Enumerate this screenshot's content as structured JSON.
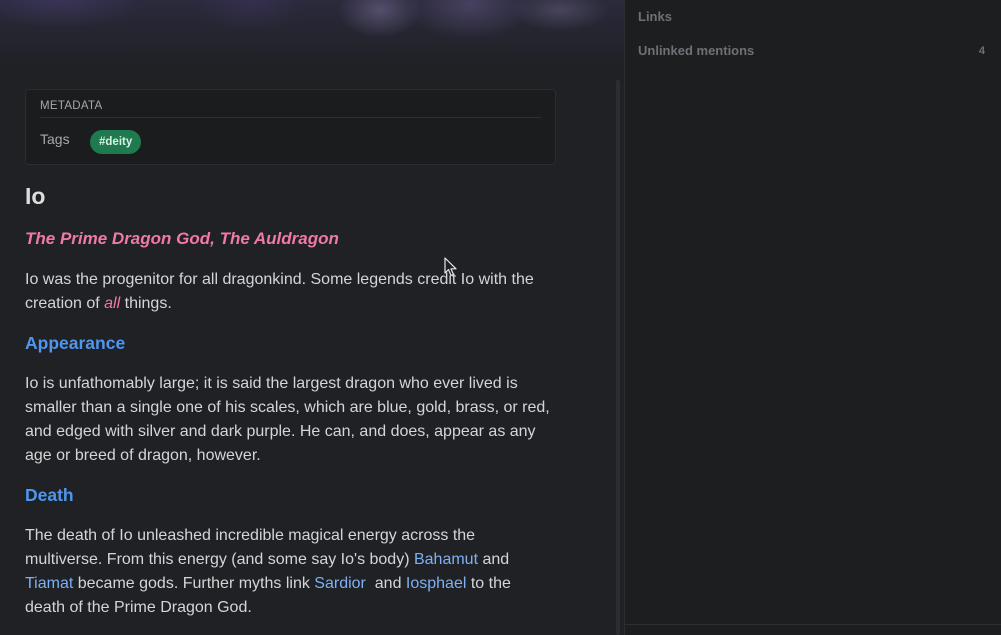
{
  "metadata": {
    "heading": "METADATA",
    "tags_key": "Tags",
    "tag": "#deity"
  },
  "note": {
    "title": "Io",
    "subtitle": "The Prime Dragon God, The Auldragon",
    "intro": {
      "part1": "Io was the progenitor for all dragonkind. Some legends credit Io with the creation of ",
      "emphasis": "all",
      "part2": " things."
    },
    "appearance": {
      "heading": "Appearance",
      "text": "Io is unfathomably large; it is said the largest dragon who ever lived is smaller than a single one of his scales, which are blue, gold, brass, or red, and edged with silver and dark purple. He can, and does, appear as any age or breed of dragon, however."
    },
    "death": {
      "heading": "Death",
      "part1": "The death of Io unleashed incredible magical energy across the multiverse. From this energy (and some say Io's body) ",
      "link1": "Bahamut",
      "part2": " and ",
      "link2": "Tiamat",
      "part3": " became gods. Further myths link ",
      "link3": "Sardior",
      "part4": "  and ",
      "link4": "Iosphael",
      "part5": " to the death of the Prime Dragon God."
    }
  },
  "sidebar": {
    "links_label": "Links",
    "unlinked_label": "Unlinked mentions",
    "unlinked_count": "4"
  },
  "colors": {
    "accent_heading": "#4e96ef",
    "link": "#7fb0f5",
    "emphasis": "#ef7aa3",
    "tag_bg": "#1f7a4f"
  }
}
